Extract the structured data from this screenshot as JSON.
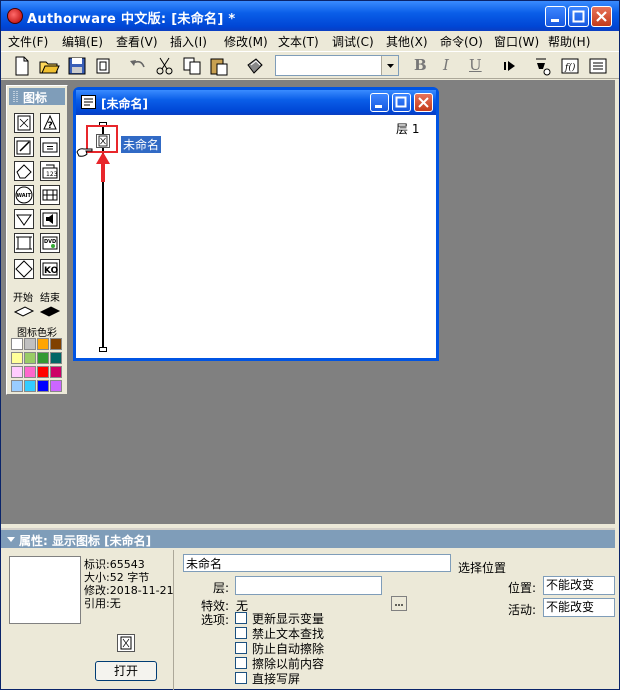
{
  "window": {
    "title": "Authorware 中文版: [未命名] *"
  },
  "menu": {
    "items": [
      "文件(F)",
      "编辑(E)",
      "查看(V)",
      "插入(I)",
      "修改(M)",
      "文本(T)",
      "调试(C)",
      "其他(X)",
      "命令(O)",
      "窗口(W)",
      "帮助(H)"
    ]
  },
  "toolbar": {
    "font_value": "",
    "bold": "B",
    "italic": "I",
    "underline": "U"
  },
  "palette": {
    "title": "图标",
    "start_label": "开始",
    "end_label": "结束",
    "color_label": "图标色彩",
    "swatches": [
      "#ffffff",
      "#c0c0c0",
      "#ffa500",
      "#804000",
      "#ffff99",
      "#99cc66",
      "#339933",
      "#006666",
      "#ffccff",
      "#ff66cc",
      "#ff0000",
      "#cc0066",
      "#99ccff",
      "#33ccff",
      "#0000ff",
      "#cc66ff"
    ]
  },
  "flow_window": {
    "title": "[未命名]",
    "layer": "层 1",
    "icon_label": "未命名"
  },
  "properties": {
    "header": "属性: 显示图标 [未命名]",
    "id_line": "标识:65543",
    "size_line": "大小:52 字节",
    "modified_line": "修改:2018-11-21",
    "ref_line": "引用:无",
    "open_button": "打开",
    "name_value": "未命名",
    "choose_position": "选择位置",
    "layer_label": "层:",
    "layer_value": "",
    "effect_label": "特效:",
    "effect_value": "无",
    "options_label": "选项:",
    "options": [
      "更新显示变量",
      "禁止文本查找",
      "防止自动擦除",
      "擦除以前内容",
      "直接写屏"
    ],
    "position_label": "位置:",
    "position_value": "不能改变",
    "activity_label": "活动:",
    "activity_value": "不能改变"
  }
}
